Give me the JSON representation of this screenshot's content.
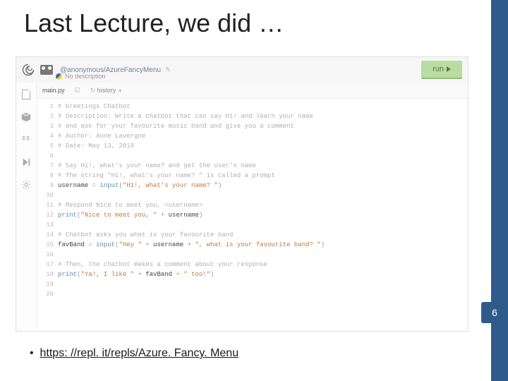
{
  "slide": {
    "title": "Last Lecture, we did …",
    "pageNumber": "6",
    "bulletMarker": "•",
    "linkText": "https: //repl. it/repls/Azure. Fancy. Menu",
    "linkHref": "https://repl.it/repls/AzureFancyMenu"
  },
  "replHeader": {
    "repoOwner": "@anonymous",
    "repoSep": "/",
    "repoName": "AzureFancyMenu",
    "noDescription": "No description",
    "runLabel": "run"
  },
  "editorTabs": {
    "main": "main.py",
    "history": "history"
  },
  "codeLines": [
    {
      "n": "1",
      "seg": [
        {
          "cls": "c-com",
          "t": "# Greetings Chatbot"
        }
      ]
    },
    {
      "n": "2",
      "seg": [
        {
          "cls": "c-com",
          "t": "# Description: Write a chatbot that can say Hi! and learn your name"
        }
      ]
    },
    {
      "n": "3",
      "seg": [
        {
          "cls": "c-com",
          "t": "#              and ask for your favourite music band and give you a comment"
        }
      ]
    },
    {
      "n": "4",
      "seg": [
        {
          "cls": "c-com",
          "t": "# Author: Anne Lavergne"
        }
      ]
    },
    {
      "n": "5",
      "seg": [
        {
          "cls": "c-com",
          "t": "# Date: May 13, 2019"
        }
      ]
    },
    {
      "n": "6",
      "seg": []
    },
    {
      "n": "7",
      "seg": [
        {
          "cls": "c-com",
          "t": "# Say Hi!, what's your name? and get the user's name"
        }
      ]
    },
    {
      "n": "8",
      "seg": [
        {
          "cls": "c-com",
          "t": "# The string \"Hi!, what's your name? \" is called a prompt"
        }
      ]
    },
    {
      "n": "9",
      "seg": [
        {
          "cls": "c-id",
          "t": "username"
        },
        {
          "cls": "c-op",
          "t": " = "
        },
        {
          "cls": "c-fn",
          "t": "input"
        },
        {
          "cls": "c-op",
          "t": "("
        },
        {
          "cls": "c-str",
          "t": "\"Hi!, what's your name? \""
        },
        {
          "cls": "c-op",
          "t": ")"
        }
      ]
    },
    {
      "n": "10",
      "seg": []
    },
    {
      "n": "11",
      "seg": [
        {
          "cls": "c-com",
          "t": "# Respond Nice to meet you, <username>"
        }
      ]
    },
    {
      "n": "12",
      "seg": [
        {
          "cls": "c-fn",
          "t": "print"
        },
        {
          "cls": "c-op",
          "t": "("
        },
        {
          "cls": "c-str",
          "t": "\"Nice to meet you, \""
        },
        {
          "cls": "c-op",
          "t": " + "
        },
        {
          "cls": "c-id",
          "t": "username"
        },
        {
          "cls": "c-op",
          "t": ")"
        }
      ]
    },
    {
      "n": "13",
      "seg": []
    },
    {
      "n": "14",
      "seg": [
        {
          "cls": "c-com",
          "t": "# Chatbot asks you what is your favourite band"
        }
      ]
    },
    {
      "n": "15",
      "seg": [
        {
          "cls": "c-id",
          "t": "favBand"
        },
        {
          "cls": "c-op",
          "t": " = "
        },
        {
          "cls": "c-fn",
          "t": "input"
        },
        {
          "cls": "c-op",
          "t": "("
        },
        {
          "cls": "c-str",
          "t": "\"Hey \""
        },
        {
          "cls": "c-op",
          "t": " + "
        },
        {
          "cls": "c-id",
          "t": "username"
        },
        {
          "cls": "c-op",
          "t": " + "
        },
        {
          "cls": "c-str",
          "t": "\", what is your favourite band? \""
        },
        {
          "cls": "c-op",
          "t": ")"
        }
      ]
    },
    {
      "n": "16",
      "seg": []
    },
    {
      "n": "17",
      "seg": [
        {
          "cls": "c-com",
          "t": "# Then, the chatbot makes a comment about your response"
        }
      ]
    },
    {
      "n": "18",
      "seg": [
        {
          "cls": "c-fn",
          "t": "print"
        },
        {
          "cls": "c-op",
          "t": "("
        },
        {
          "cls": "c-str",
          "t": "\"Ya!, I like \""
        },
        {
          "cls": "c-op",
          "t": " + "
        },
        {
          "cls": "c-id",
          "t": "favBand"
        },
        {
          "cls": "c-op",
          "t": " + "
        },
        {
          "cls": "c-str",
          "t": "\" too!\""
        },
        {
          "cls": "c-op",
          "t": ")"
        }
      ]
    },
    {
      "n": "19",
      "seg": []
    },
    {
      "n": "20",
      "seg": []
    }
  ]
}
